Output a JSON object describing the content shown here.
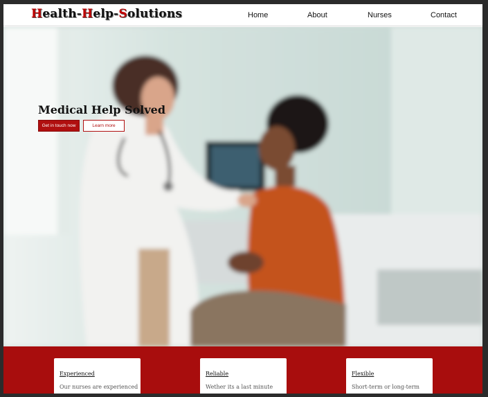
{
  "header": {
    "logo": [
      {
        "cap": "H",
        "rest": "ealth-"
      },
      {
        "cap": "H",
        "rest": "elp-"
      },
      {
        "cap": "S",
        "rest": "olutions"
      }
    ],
    "nav": [
      "Home",
      "About",
      "Nurses",
      "Contact"
    ]
  },
  "hero": {
    "title": "Medical Help Solved",
    "primary_button": "Get in touch now",
    "secondary_button": "Learn more"
  },
  "features": [
    {
      "title": "Experienced",
      "text": "Our nurses are experienced"
    },
    {
      "title": "Reliable",
      "text": "Wether its a last minute"
    },
    {
      "title": "Flexible",
      "text": "Short-term or long-term"
    }
  ],
  "colors": {
    "brand_red": "#a80d0d",
    "button_red": "#b00f0f",
    "logo_red": "#c00000"
  }
}
